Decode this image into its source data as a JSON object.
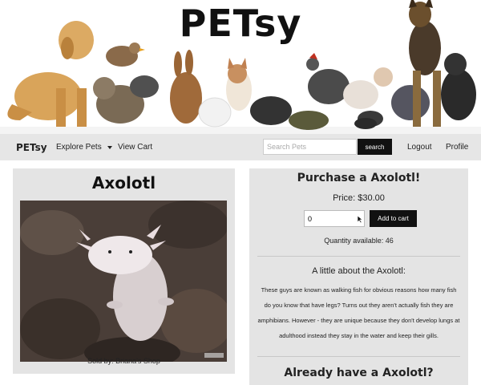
{
  "banner": {
    "title": "PETsy"
  },
  "nav": {
    "brand": "PETsy",
    "explore_label": "Explore Pets",
    "cart_label": "View Cart",
    "search_placeholder": "Search Pets",
    "search_button": "search",
    "logout_label": "Logout",
    "profile_label": "Profile"
  },
  "pet": {
    "name": "Axolotl",
    "sold_by": "Sold by: Briana's Shop"
  },
  "purchase": {
    "title": "Purchase a Axolotl!",
    "price": "Price: $30.00",
    "quantity_value": "0",
    "add_button": "Add to cart",
    "quantity_available": "Quantity available: 46"
  },
  "about": {
    "title": "A little about the Axolotl:",
    "text": "These guys are known as walking fish for obvious reasons how many fish do you know that have legs? Turns out they aren't actually fish they are amphibians. However - they are unique because they don't develop lungs at adulthood instead they stay in the water and keep their gills."
  },
  "review": {
    "title": "Already have a Axolotl?"
  },
  "icons": {
    "dropdown": "chevron-down-icon",
    "cursor": "mouse-pointer-icon"
  },
  "colors": {
    "button_bg": "#111111",
    "panel_bg": "#e4e4e4",
    "nav_bg": "#e6e6e6"
  }
}
